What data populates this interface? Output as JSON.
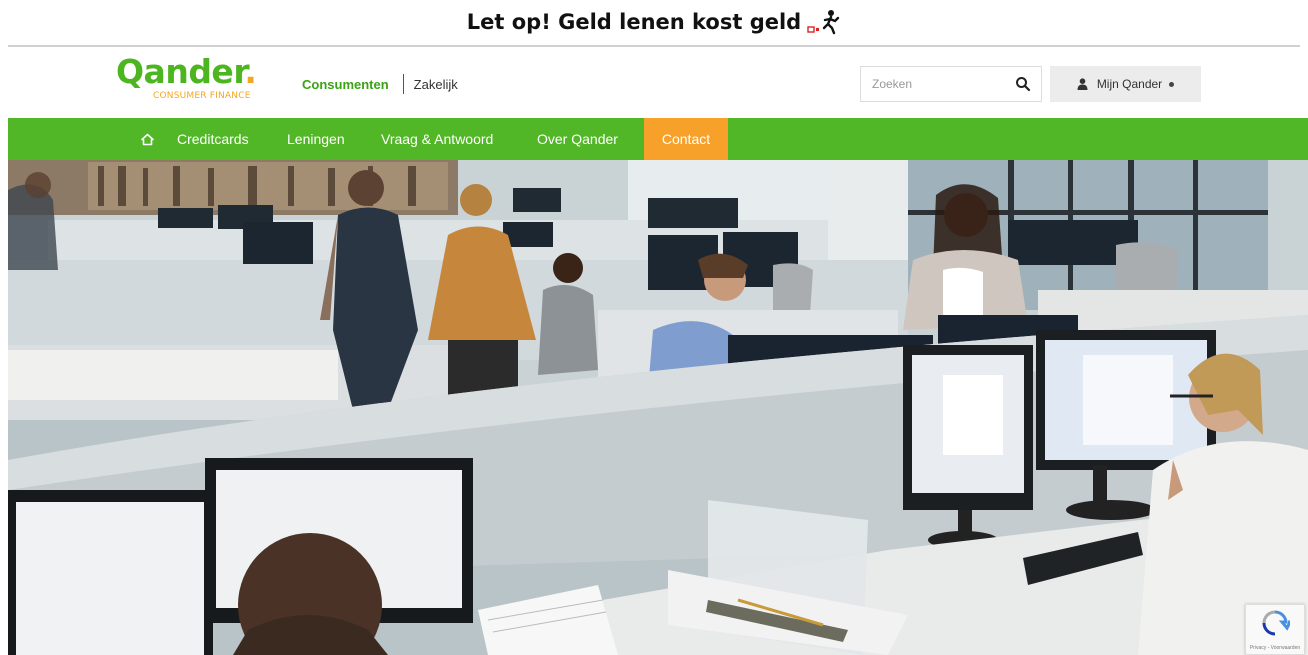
{
  "warning": {
    "text": "Let op! Geld lenen kost geld"
  },
  "header": {
    "logo": {
      "word": "Qander",
      "dot": ".",
      "tagline": "CONSUMER FINANCE"
    },
    "segments": {
      "active": "Consumenten",
      "other": "Zakelijk"
    },
    "search": {
      "placeholder": "Zoeken"
    },
    "account": {
      "label": "Mijn Qander"
    }
  },
  "nav": {
    "items": [
      {
        "label": "Creditcards"
      },
      {
        "label": "Leningen"
      },
      {
        "label": "Vraag & Antwoord"
      },
      {
        "label": "Over Qander"
      },
      {
        "label": "Contact",
        "active": true
      }
    ]
  },
  "colors": {
    "brand_green": "#52b727",
    "accent_orange": "#f7a12b",
    "logo_green": "#4cb51f"
  },
  "recaptcha": {
    "label": "Privacy - Voorwaarden"
  }
}
